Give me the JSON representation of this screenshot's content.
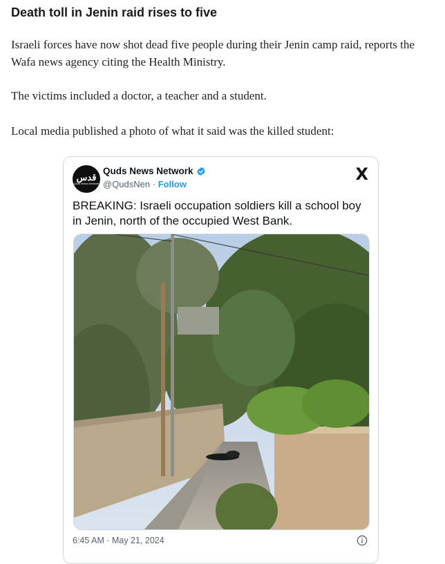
{
  "article": {
    "headline": "Death toll in Jenin raid rises to five",
    "paragraphs": [
      "Israeli forces have now shot dead five people during their Jenin camp raid, reports the Wafa news agency citing the Health Ministry.",
      "The victims included a doctor, a teacher and a student.",
      "Local media published a photo of what it said was the killed student:"
    ]
  },
  "tweet": {
    "account_name": "Quds News Network",
    "avatar_text": "قدس",
    "avatar_subtext": "Quds News Network",
    "handle": "@QudsNen",
    "separator": " · ",
    "follow_label": "Follow",
    "text": "BREAKING: Israeli occupation soldiers kill a school boy in Jenin, north of the occupied West Bank.",
    "timestamp": "6:45 AM · May 21, 2024",
    "x_logo": "X",
    "verified": true,
    "icons": {
      "verified": "verified-badge-icon",
      "brand": "x-logo-icon",
      "info": "info-icon"
    },
    "colors": {
      "accent": "#1d9bf0",
      "text": "#0f1419",
      "muted": "#536471",
      "border": "#cfd9de"
    }
  }
}
